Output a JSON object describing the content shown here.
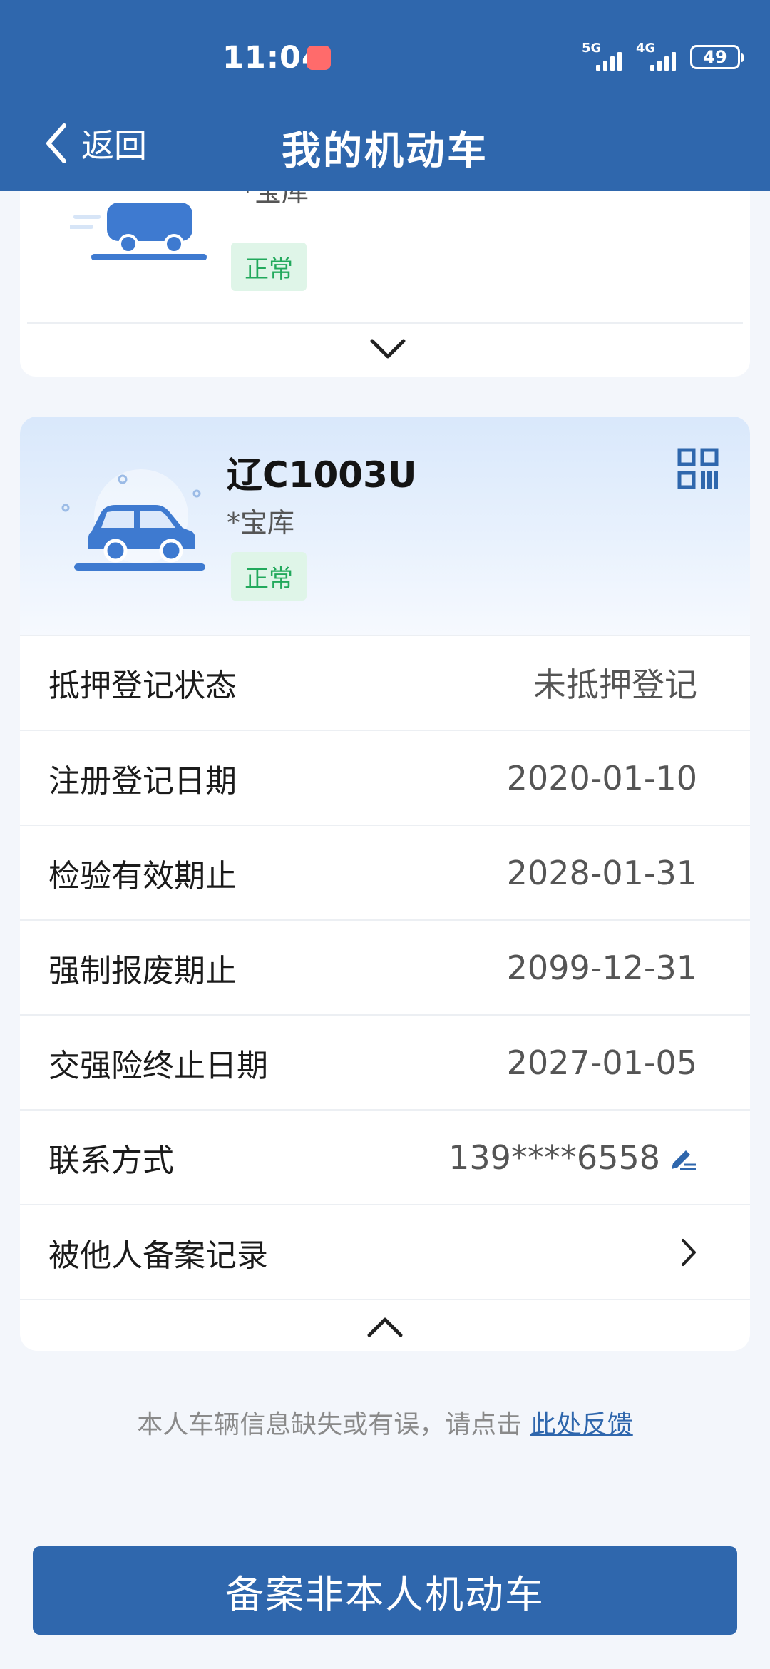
{
  "status_bar": {
    "time": "11:04",
    "net1": "5G",
    "net2": "4G",
    "battery": "49"
  },
  "header": {
    "back_label": "返回",
    "title": "我的机动车"
  },
  "vehicle_prev": {
    "owner": "*宝库",
    "status": "正常"
  },
  "vehicle": {
    "plate": "辽C1003U",
    "owner": "*宝库",
    "status": "正常",
    "rows": [
      {
        "label": "抵押登记状态",
        "value": "未抵押登记"
      },
      {
        "label": "注册登记日期",
        "value": "2020-01-10"
      },
      {
        "label": "检验有效期止",
        "value": "2028-01-31"
      },
      {
        "label": "强制报废期止",
        "value": "2099-12-31"
      },
      {
        "label": "交强险终止日期",
        "value": "2027-01-05"
      },
      {
        "label": "联系方式",
        "value": "139****6558"
      },
      {
        "label": "被他人备案记录",
        "value": ""
      }
    ]
  },
  "footer": {
    "feedback_text": "本人车辆信息缺失或有误，请点击",
    "feedback_link": "此处反馈",
    "primary_button": "备案非本人机动车"
  },
  "colors": {
    "brand": "#2f67ad",
    "status_green": "#22a95c",
    "status_bg": "#dff5e8"
  },
  "icons": [
    "back-chevron-icon",
    "car-icon",
    "qr-code-icon",
    "edit-icon",
    "chevron-right-icon",
    "chevron-down-icon",
    "chevron-up-icon"
  ]
}
